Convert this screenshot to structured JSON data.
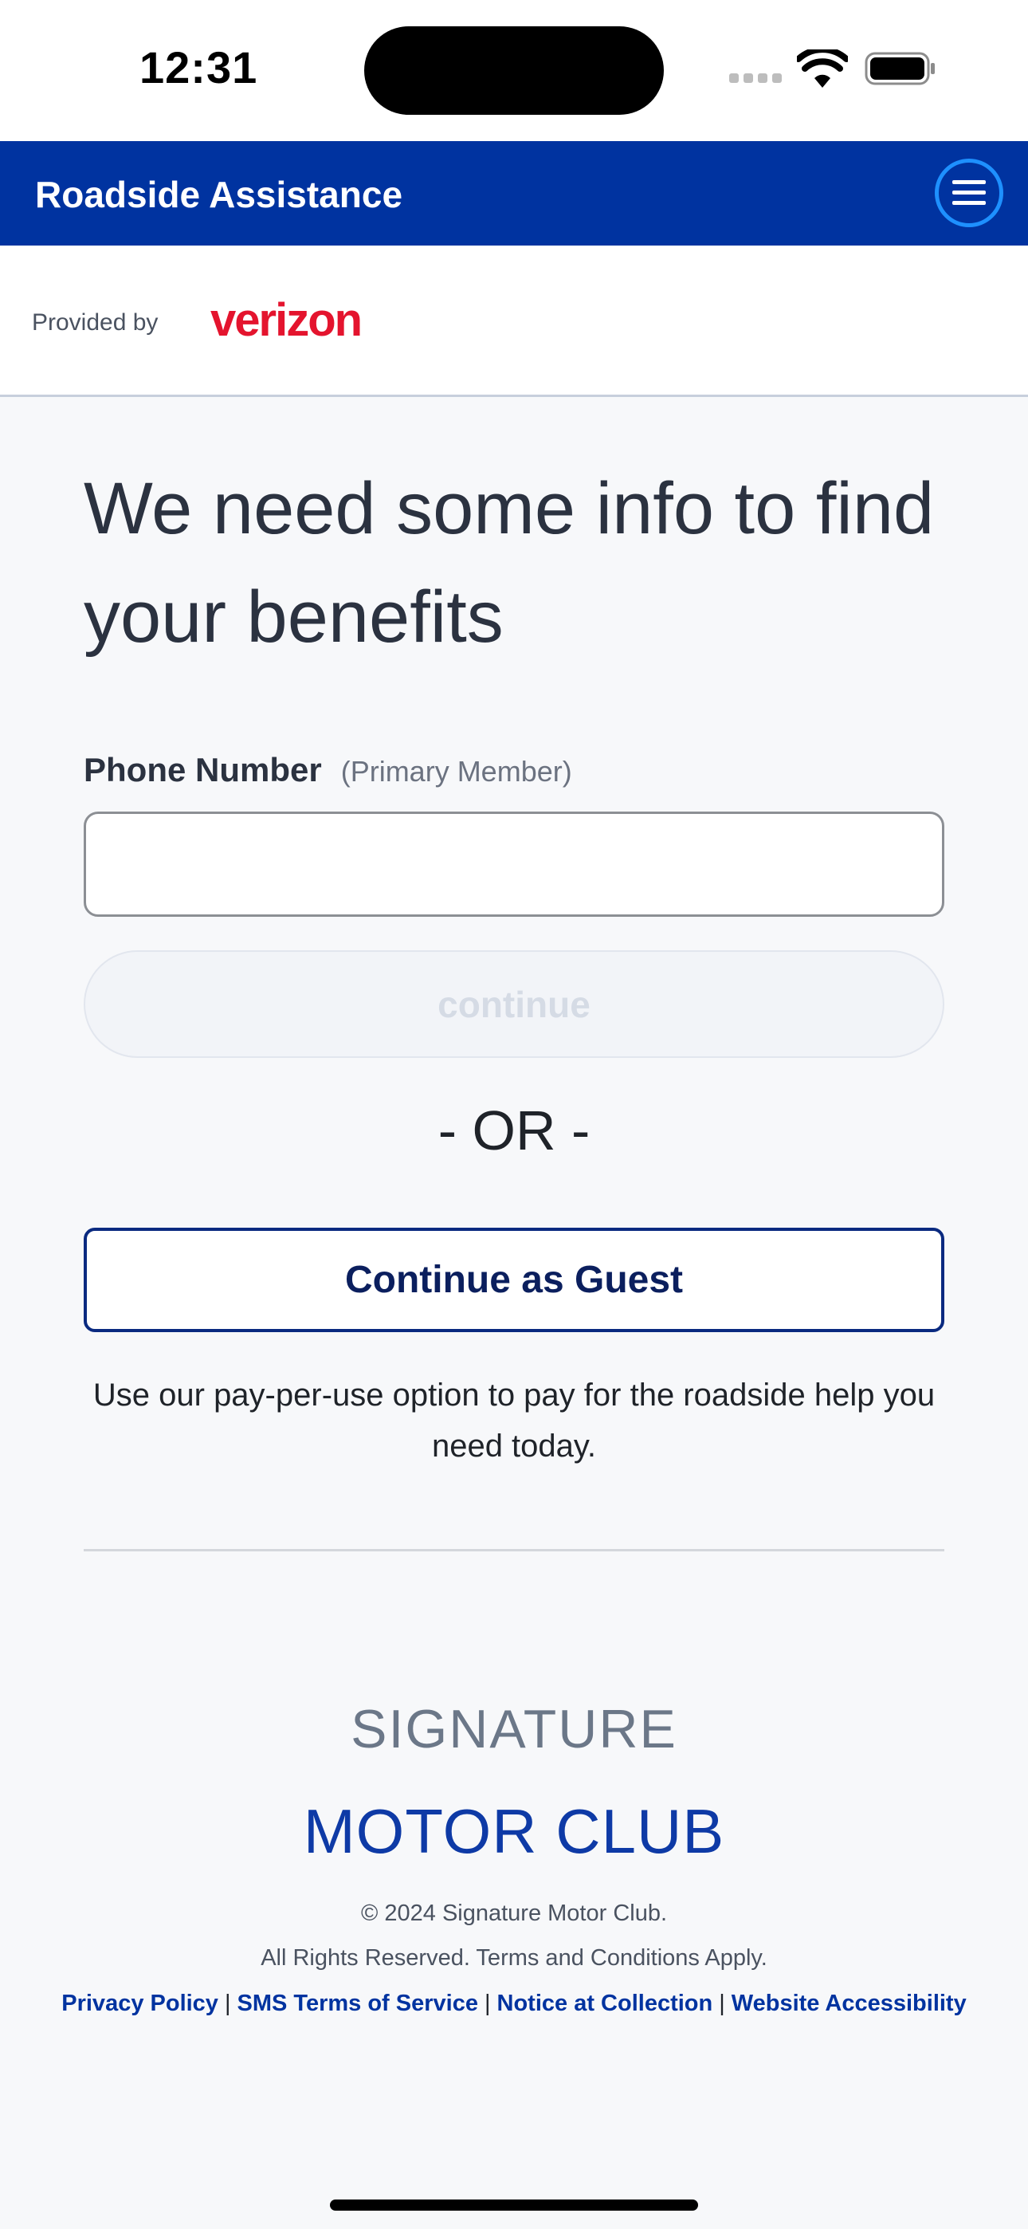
{
  "status_bar": {
    "time": "12:31"
  },
  "header": {
    "title": "Roadside Assistance"
  },
  "provider": {
    "label": "Provided by",
    "brand": "verizon"
  },
  "main": {
    "headline": "We need some info to find your benefits",
    "phone_label": "Phone Number",
    "phone_sublabel": "(Primary Member)",
    "phone_value": "",
    "continue_label": "continue",
    "or_text": "- OR -",
    "guest_label": "Continue as Guest",
    "guest_description": "Use our pay-per-use option to pay for the roadside help you need today."
  },
  "footer": {
    "brand_line1": "SIGNATURE",
    "brand_line2": "MOTOR CLUB",
    "copyright": "© 2024 Signature Motor Club.",
    "rights": "All Rights Reserved. Terms and Conditions Apply.",
    "links": {
      "privacy": "Privacy Policy",
      "sms": "SMS Terms of Service",
      "notice": "Notice at Collection",
      "accessibility": "Website Accessibility"
    },
    "separator": "|"
  },
  "colors": {
    "header_bg": "#0033a0",
    "verizon_red": "#e4142e",
    "brand_blue": "#0e3aa6",
    "guest_border": "#0a2a80"
  }
}
